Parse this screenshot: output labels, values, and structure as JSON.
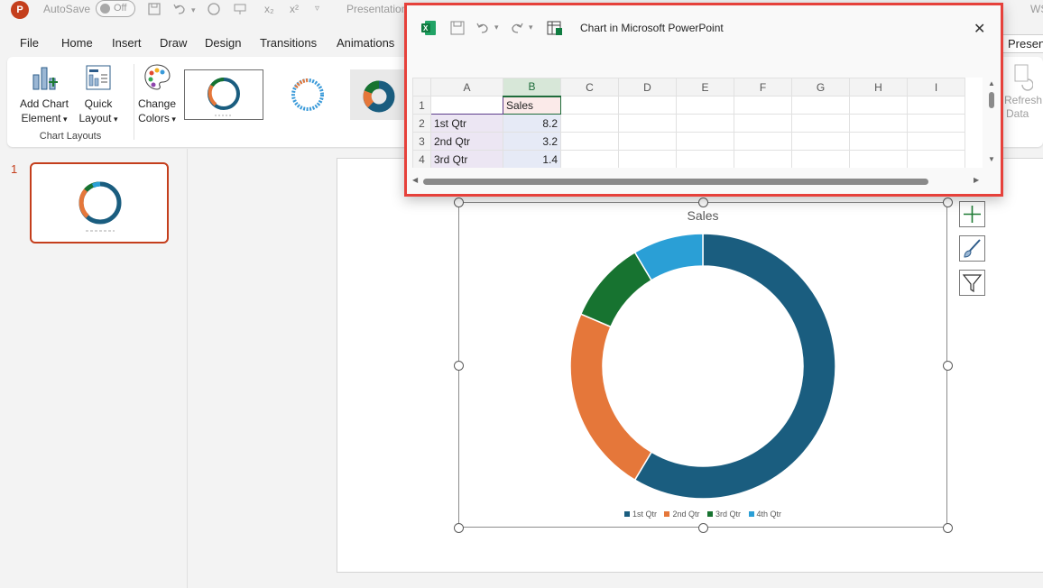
{
  "titlebar": {
    "autosave_label": "AutoSave",
    "autosave_state": "Off",
    "doc_title": "Presentation",
    "right_initials": "WS"
  },
  "menu": {
    "items": [
      "File",
      "Home",
      "Insert",
      "Draw",
      "Design",
      "Transitions",
      "Animations"
    ],
    "present_label": "Presen"
  },
  "ribbon": {
    "add_chart_element": [
      "Add Chart",
      "Element"
    ],
    "quick_layout": [
      "Quick",
      "Layout"
    ],
    "change_colors": [
      "Change",
      "Colors"
    ],
    "group_label": "Chart Layouts",
    "refresh_data": [
      "Refresh",
      "Data"
    ]
  },
  "thumbnails": {
    "slide_number": "1"
  },
  "excel": {
    "title": "Chart in Microsoft PowerPoint",
    "columns": [
      "A",
      "B",
      "C",
      "D",
      "E",
      "F",
      "G",
      "H",
      "I"
    ],
    "rows": [
      {
        "num": "1",
        "a": "",
        "b": "Sales"
      },
      {
        "num": "2",
        "a": "1st Qtr",
        "b": "8.2"
      },
      {
        "num": "3",
        "a": "2nd Qtr",
        "b": "3.2"
      },
      {
        "num": "4",
        "a": "3rd Qtr",
        "b": "1.4"
      }
    ]
  },
  "chart_data": {
    "type": "pie",
    "title": "Sales",
    "categories": [
      "1st Qtr",
      "2nd Qtr",
      "3rd Qtr",
      "4th Qtr"
    ],
    "values": [
      8.2,
      3.2,
      1.4,
      1.2
    ],
    "colors": [
      "#1a5d7f",
      "#e5773a",
      "#177330",
      "#2a9fd6"
    ],
    "legend": "bottom",
    "style": "doughnut"
  }
}
